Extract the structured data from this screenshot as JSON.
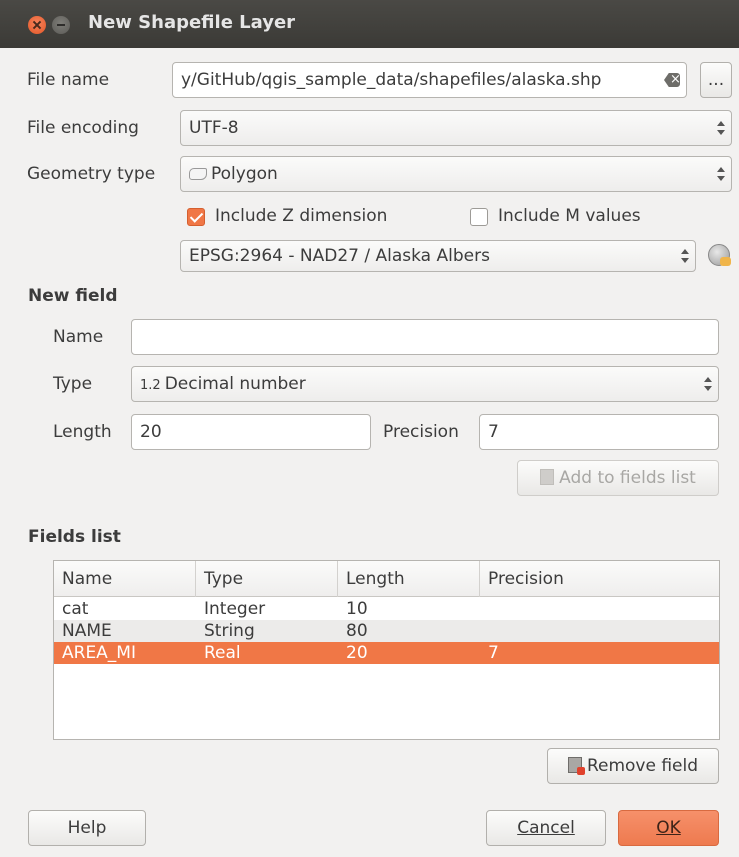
{
  "window": {
    "title": "New Shapefile Layer"
  },
  "file": {
    "label": "File name",
    "value": "y/GitHub/qgis_sample_data/shapefiles/alaska.shp",
    "browse_label": "..."
  },
  "encoding": {
    "label": "File encoding",
    "value": "UTF-8"
  },
  "geometry": {
    "label": "Geometry type",
    "value": "Polygon",
    "icon": "polygon-icon"
  },
  "options": {
    "z_label": "Include Z dimension",
    "z_checked": true,
    "m_label": "Include M values",
    "m_checked": false
  },
  "crs": {
    "value": "EPSG:2964 - NAD27 / Alaska Albers",
    "icon": "select-crs-globe-icon"
  },
  "new_field": {
    "heading": "New field",
    "name_label": "Name",
    "name_value": "",
    "type_label": "Type",
    "type_prefix": "1.2",
    "type_value": "Decimal number",
    "length_label": "Length",
    "length_value": "20",
    "precision_label": "Precision",
    "precision_value": "7",
    "add_button": "Add to fields list"
  },
  "fields_list": {
    "heading": "Fields list",
    "columns": [
      "Name",
      "Type",
      "Length",
      "Precision"
    ],
    "rows": [
      [
        "cat",
        "Integer",
        "10",
        ""
      ],
      [
        "NAME",
        "String",
        "80",
        ""
      ],
      [
        "AREA_MI",
        "Real",
        "20",
        "7"
      ]
    ],
    "selected_row": 2,
    "remove_button": "Remove field"
  },
  "buttons": {
    "help": "Help",
    "cancel": "Cancel",
    "ok": "OK"
  },
  "colors": {
    "accent": "#f07746",
    "titlebar": "#3e3d39"
  }
}
